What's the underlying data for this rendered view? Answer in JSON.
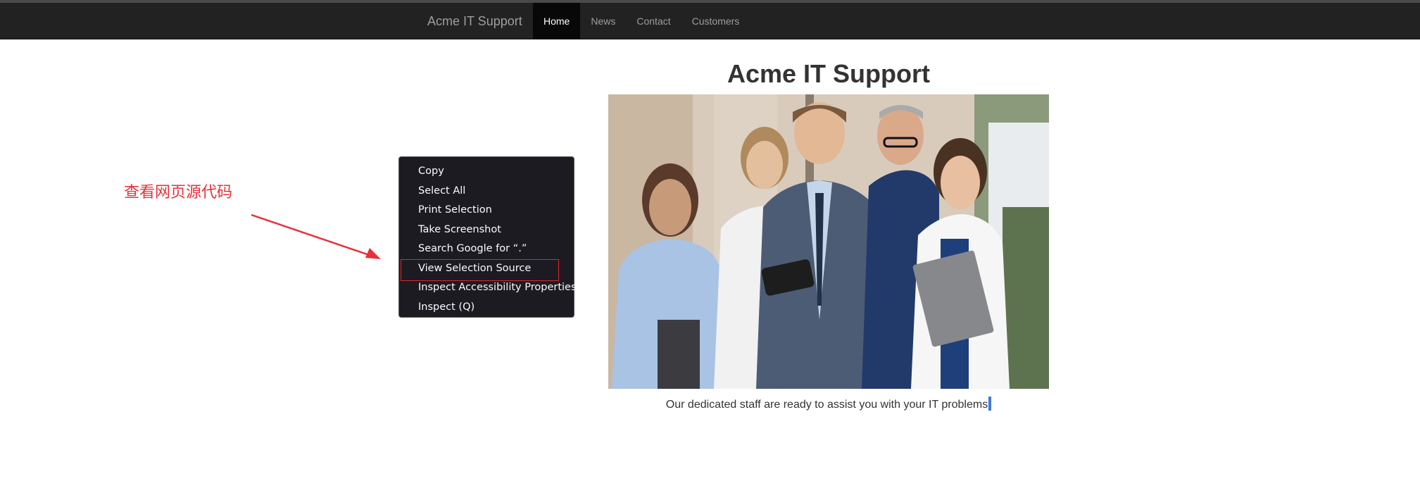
{
  "navbar": {
    "brand": "Acme IT Support",
    "items": [
      {
        "label": "Home",
        "active": true
      },
      {
        "label": "News",
        "active": false
      },
      {
        "label": "Contact",
        "active": false
      },
      {
        "label": "Customers",
        "active": false
      }
    ]
  },
  "main": {
    "title": "Acme IT Support",
    "caption": "Our dedicated staff are ready to assist you with your IT problems"
  },
  "annotation": {
    "text": "查看网页源代码",
    "color": "#e8303a"
  },
  "context_menu": {
    "items": [
      {
        "label": "Copy",
        "highlighted": false
      },
      {
        "label": "Select All",
        "highlighted": false
      },
      {
        "label": "Print Selection",
        "highlighted": false
      },
      {
        "label": "Take Screenshot",
        "highlighted": false
      },
      {
        "label": "Search Google for “.”",
        "highlighted": false
      },
      {
        "label": "View Selection Source",
        "highlighted": true
      },
      {
        "label": "Inspect Accessibility Properties",
        "highlighted": false
      },
      {
        "label": "Inspect (Q)",
        "highlighted": false
      }
    ]
  },
  "colors": {
    "navbar_bg": "#222222",
    "nav_active_bg": "#080808",
    "menu_bg": "#1c1b22",
    "highlight_border": "#e3262e",
    "selection": "#3d7bd8"
  }
}
